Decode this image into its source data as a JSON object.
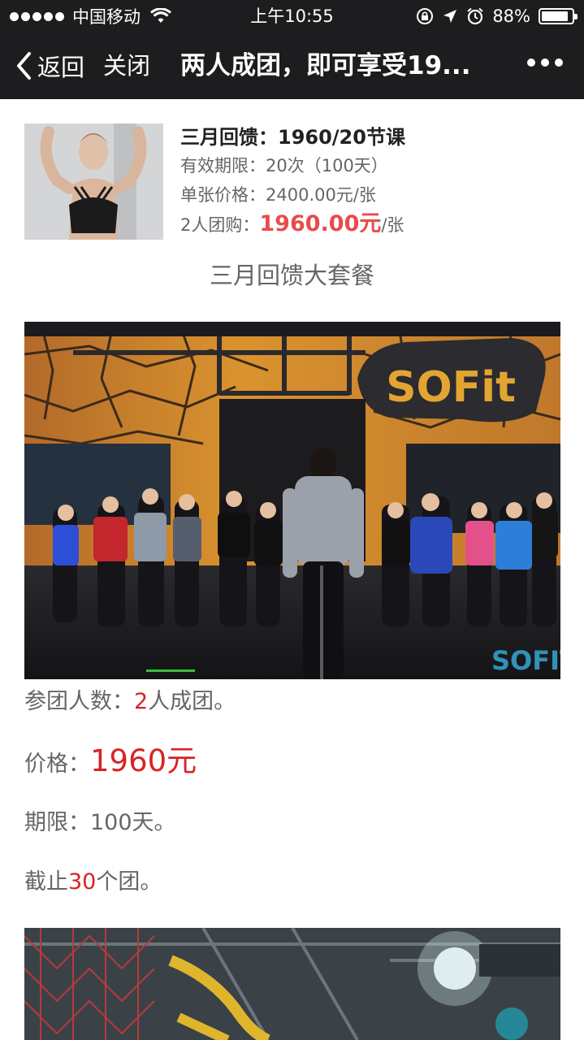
{
  "status_bar": {
    "carrier": "中国移动",
    "time": "上午10:55",
    "battery": "88%",
    "battery_level": 0.88
  },
  "nav": {
    "back_label": "返回",
    "close_label": "关闭",
    "title": "两人成团，即可享受19..."
  },
  "product": {
    "title": "三月回馈：1960/20节课",
    "validity": "有效期限：20次（100天）",
    "unit_price": "单张价格：2400.00元/张",
    "group_label": "2人团购：",
    "group_price": "1960.00元",
    "group_unit": "/张"
  },
  "section_heading": "三月回馈大套餐",
  "photo": {
    "brand_sign": "SOFit",
    "watermark": "SOFIT"
  },
  "details": {
    "members_label": "参团人数：",
    "members_value": "2",
    "members_suffix": "人成团。",
    "price_label": "价格：",
    "price_value": "1960元",
    "term_label": "期限：",
    "term_value": "100天。",
    "deadline_prefix": "截止",
    "deadline_value": "30",
    "deadline_suffix": "个团。"
  },
  "colors": {
    "bar_bg": "#1d1d1f",
    "accent_red": "#e84c4c",
    "deep_red": "#d82323"
  }
}
